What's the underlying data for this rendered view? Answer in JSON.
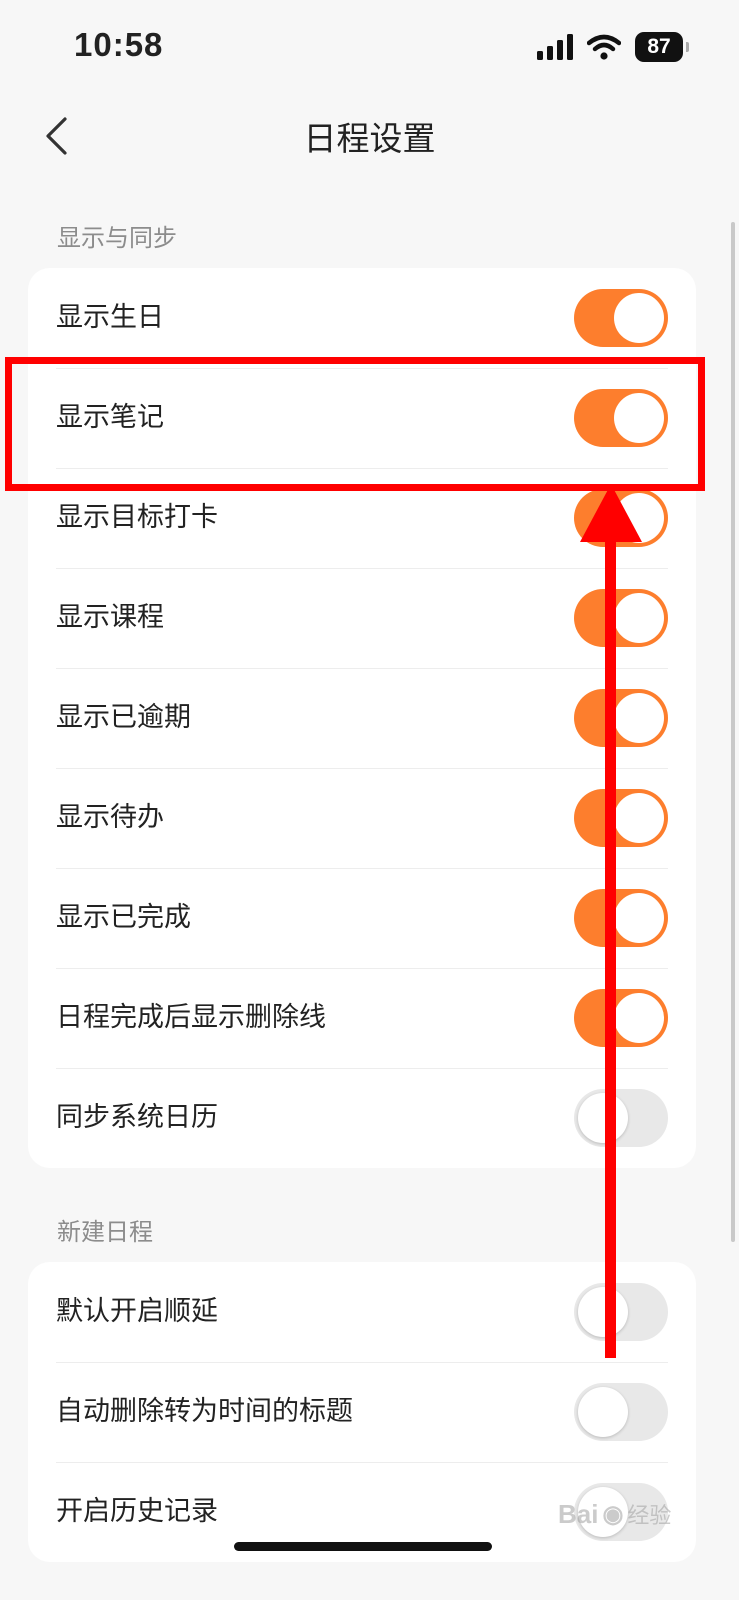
{
  "status_bar": {
    "time": "10:58",
    "battery": "87"
  },
  "nav": {
    "title": "日程设置"
  },
  "sections": [
    {
      "header": "显示与同步",
      "items": [
        {
          "label": "显示生日",
          "on": true
        },
        {
          "label": "显示笔记",
          "on": true
        },
        {
          "label": "显示目标打卡",
          "on": true
        },
        {
          "label": "显示课程",
          "on": true
        },
        {
          "label": "显示已逾期",
          "on": true
        },
        {
          "label": "显示待办",
          "on": true
        },
        {
          "label": "显示已完成",
          "on": true
        },
        {
          "label": "日程完成后显示删除线",
          "on": true
        },
        {
          "label": "同步系统日历",
          "on": false
        }
      ]
    },
    {
      "header": "新建日程",
      "items": [
        {
          "label": "默认开启顺延",
          "on": false
        },
        {
          "label": "自动删除转为时间的标题",
          "on": false
        },
        {
          "label": "开启历史记录",
          "on": false
        }
      ]
    }
  ],
  "colors": {
    "accent": "#fd7e2d",
    "annotation": "#ff0000"
  },
  "watermark": {
    "text1": "Bai",
    "text2": "经验"
  }
}
